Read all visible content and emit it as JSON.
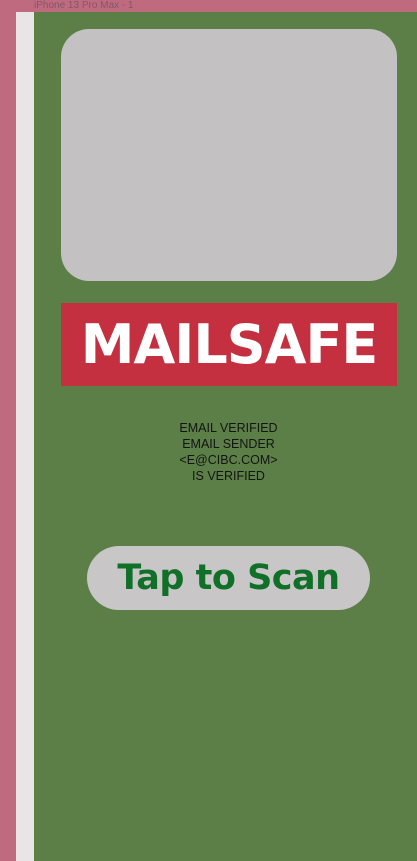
{
  "frame": {
    "label": "iPhone 13 Pro Max - 1"
  },
  "brand": {
    "name": "MAILSAFE",
    "colors": {
      "banner": "#c53040",
      "text": "#ffffff"
    }
  },
  "status": {
    "line1": "EMAIL VERIFIED",
    "line2": "EMAIL SENDER",
    "line3": "<E@CIBC.COM>",
    "line4": "IS VERIFIED"
  },
  "scan_button": {
    "label": "Tap to Scan",
    "colors": {
      "background": "#c9c6c7",
      "text": "#117028"
    }
  },
  "theme": {
    "screen_background": "#5b7f47",
    "outer_background": "#c06a80",
    "placeholder": "#c4c1c2"
  }
}
